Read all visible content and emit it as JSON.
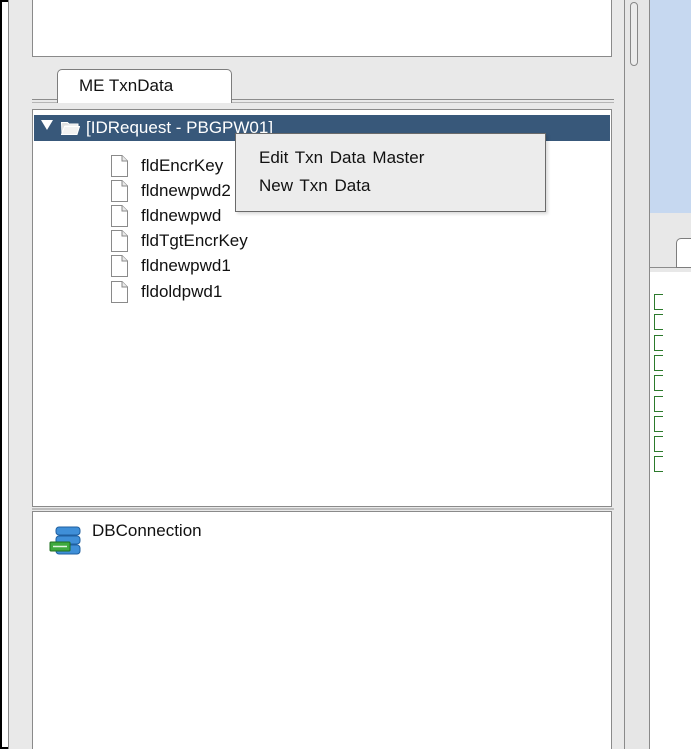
{
  "tabs": {
    "txn_data_label": "ME TxnData"
  },
  "tree": {
    "root_label": "[IDRequest - PBGPW01]",
    "children": [
      "fldEncrKey",
      "fldnewpwd2",
      "fldnewpwd",
      "fldTgtEncrKey",
      "fldnewpwd1",
      "fldoldpwd1"
    ]
  },
  "context_menu": {
    "items": [
      "Edit  Txn Data Master",
      "New  Txn Data"
    ]
  },
  "db_panel": {
    "connection_label": "DBConnection"
  },
  "colors": {
    "tree_selection": "#38587a",
    "right_panel_blue": "#c6d8f0",
    "bracket_green": "#2c7a2c"
  },
  "icons": [
    "folder-open-icon",
    "file-icon",
    "database-icon",
    "tree-expand-arrow-icon"
  ]
}
